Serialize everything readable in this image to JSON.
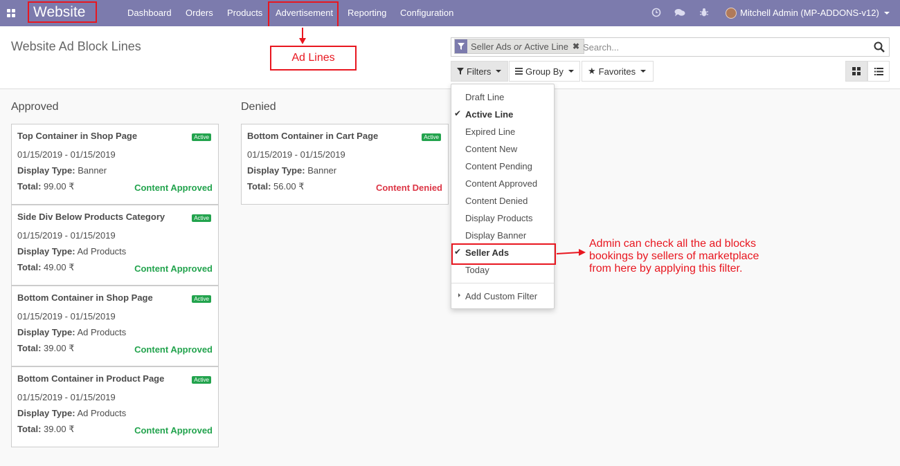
{
  "navbar": {
    "brand": "Website",
    "menu": [
      "Dashboard",
      "Orders",
      "Products",
      "Advertisement",
      "Reporting",
      "Configuration"
    ],
    "user": "Mitchell Admin (MP-ADDONS-v12)"
  },
  "control": {
    "title": "Website Ad Block Lines",
    "facet": {
      "a": "Seller Ads",
      "or": "or",
      "b": "Active Line"
    },
    "search_placeholder": "Search...",
    "filters": "Filters",
    "group_by": "Group By",
    "favorites": "Favorites"
  },
  "annotation": {
    "ad_lines": "Ad Lines",
    "note": "Admin can check all the ad blocks bookings by sellers of marketplace from here by applying this filter."
  },
  "filter_menu": {
    "items": [
      "Draft Line",
      "Active Line",
      "Expired Line",
      "Content New",
      "Content Pending",
      "Content Approved",
      "Content Denied",
      "Display Products",
      "Display Banner",
      "Seller Ads",
      "Today"
    ],
    "custom": "Add Custom Filter"
  },
  "kanban": {
    "columns": [
      {
        "title": "Approved",
        "cards": [
          {
            "name": "Top Container in Shop Page",
            "badge": "Active",
            "dates": "01/15/2019 - 01/15/2019",
            "type_label": "Display Type:",
            "type": "Banner",
            "total_label": "Total:",
            "total": "99.00 ₹",
            "status": "Content Approved"
          },
          {
            "name": "Side Div Below Products Category",
            "badge": "Active",
            "dates": "01/15/2019 - 01/15/2019",
            "type_label": "Display Type:",
            "type": "Ad Products",
            "total_label": "Total:",
            "total": "49.00 ₹",
            "status": "Content Approved"
          },
          {
            "name": "Bottom Container in Shop Page",
            "badge": "Active",
            "dates": "01/15/2019 - 01/15/2019",
            "type_label": "Display Type:",
            "type": "Ad Products",
            "total_label": "Total:",
            "total": "39.00 ₹",
            "status": "Content Approved"
          },
          {
            "name": "Bottom Container in Product Page",
            "badge": "Active",
            "dates": "01/15/2019 - 01/15/2019",
            "type_label": "Display Type:",
            "type": "Ad Products",
            "total_label": "Total:",
            "total": "39.00 ₹",
            "status": "Content Approved"
          }
        ]
      },
      {
        "title": "Denied",
        "cards": [
          {
            "name": "Bottom Container in Cart Page",
            "badge": "Active",
            "dates": "01/15/2019 - 01/15/2019",
            "type_label": "Display Type:",
            "type": "Banner",
            "total_label": "Total:",
            "total": "56.00 ₹",
            "status": "Content Denied"
          }
        ]
      }
    ]
  },
  "colors": {
    "navbar": "#7c7bad",
    "approved": "#22a34d",
    "denied": "#dc3545",
    "annotation": "#e8161f"
  },
  "icons": [
    "apps-icon",
    "clock-icon",
    "chat-icon",
    "bug-icon",
    "search-icon",
    "filter-icon",
    "list-icon",
    "star-icon",
    "kanban-view-icon",
    "list-view-icon",
    "check-icon"
  ]
}
